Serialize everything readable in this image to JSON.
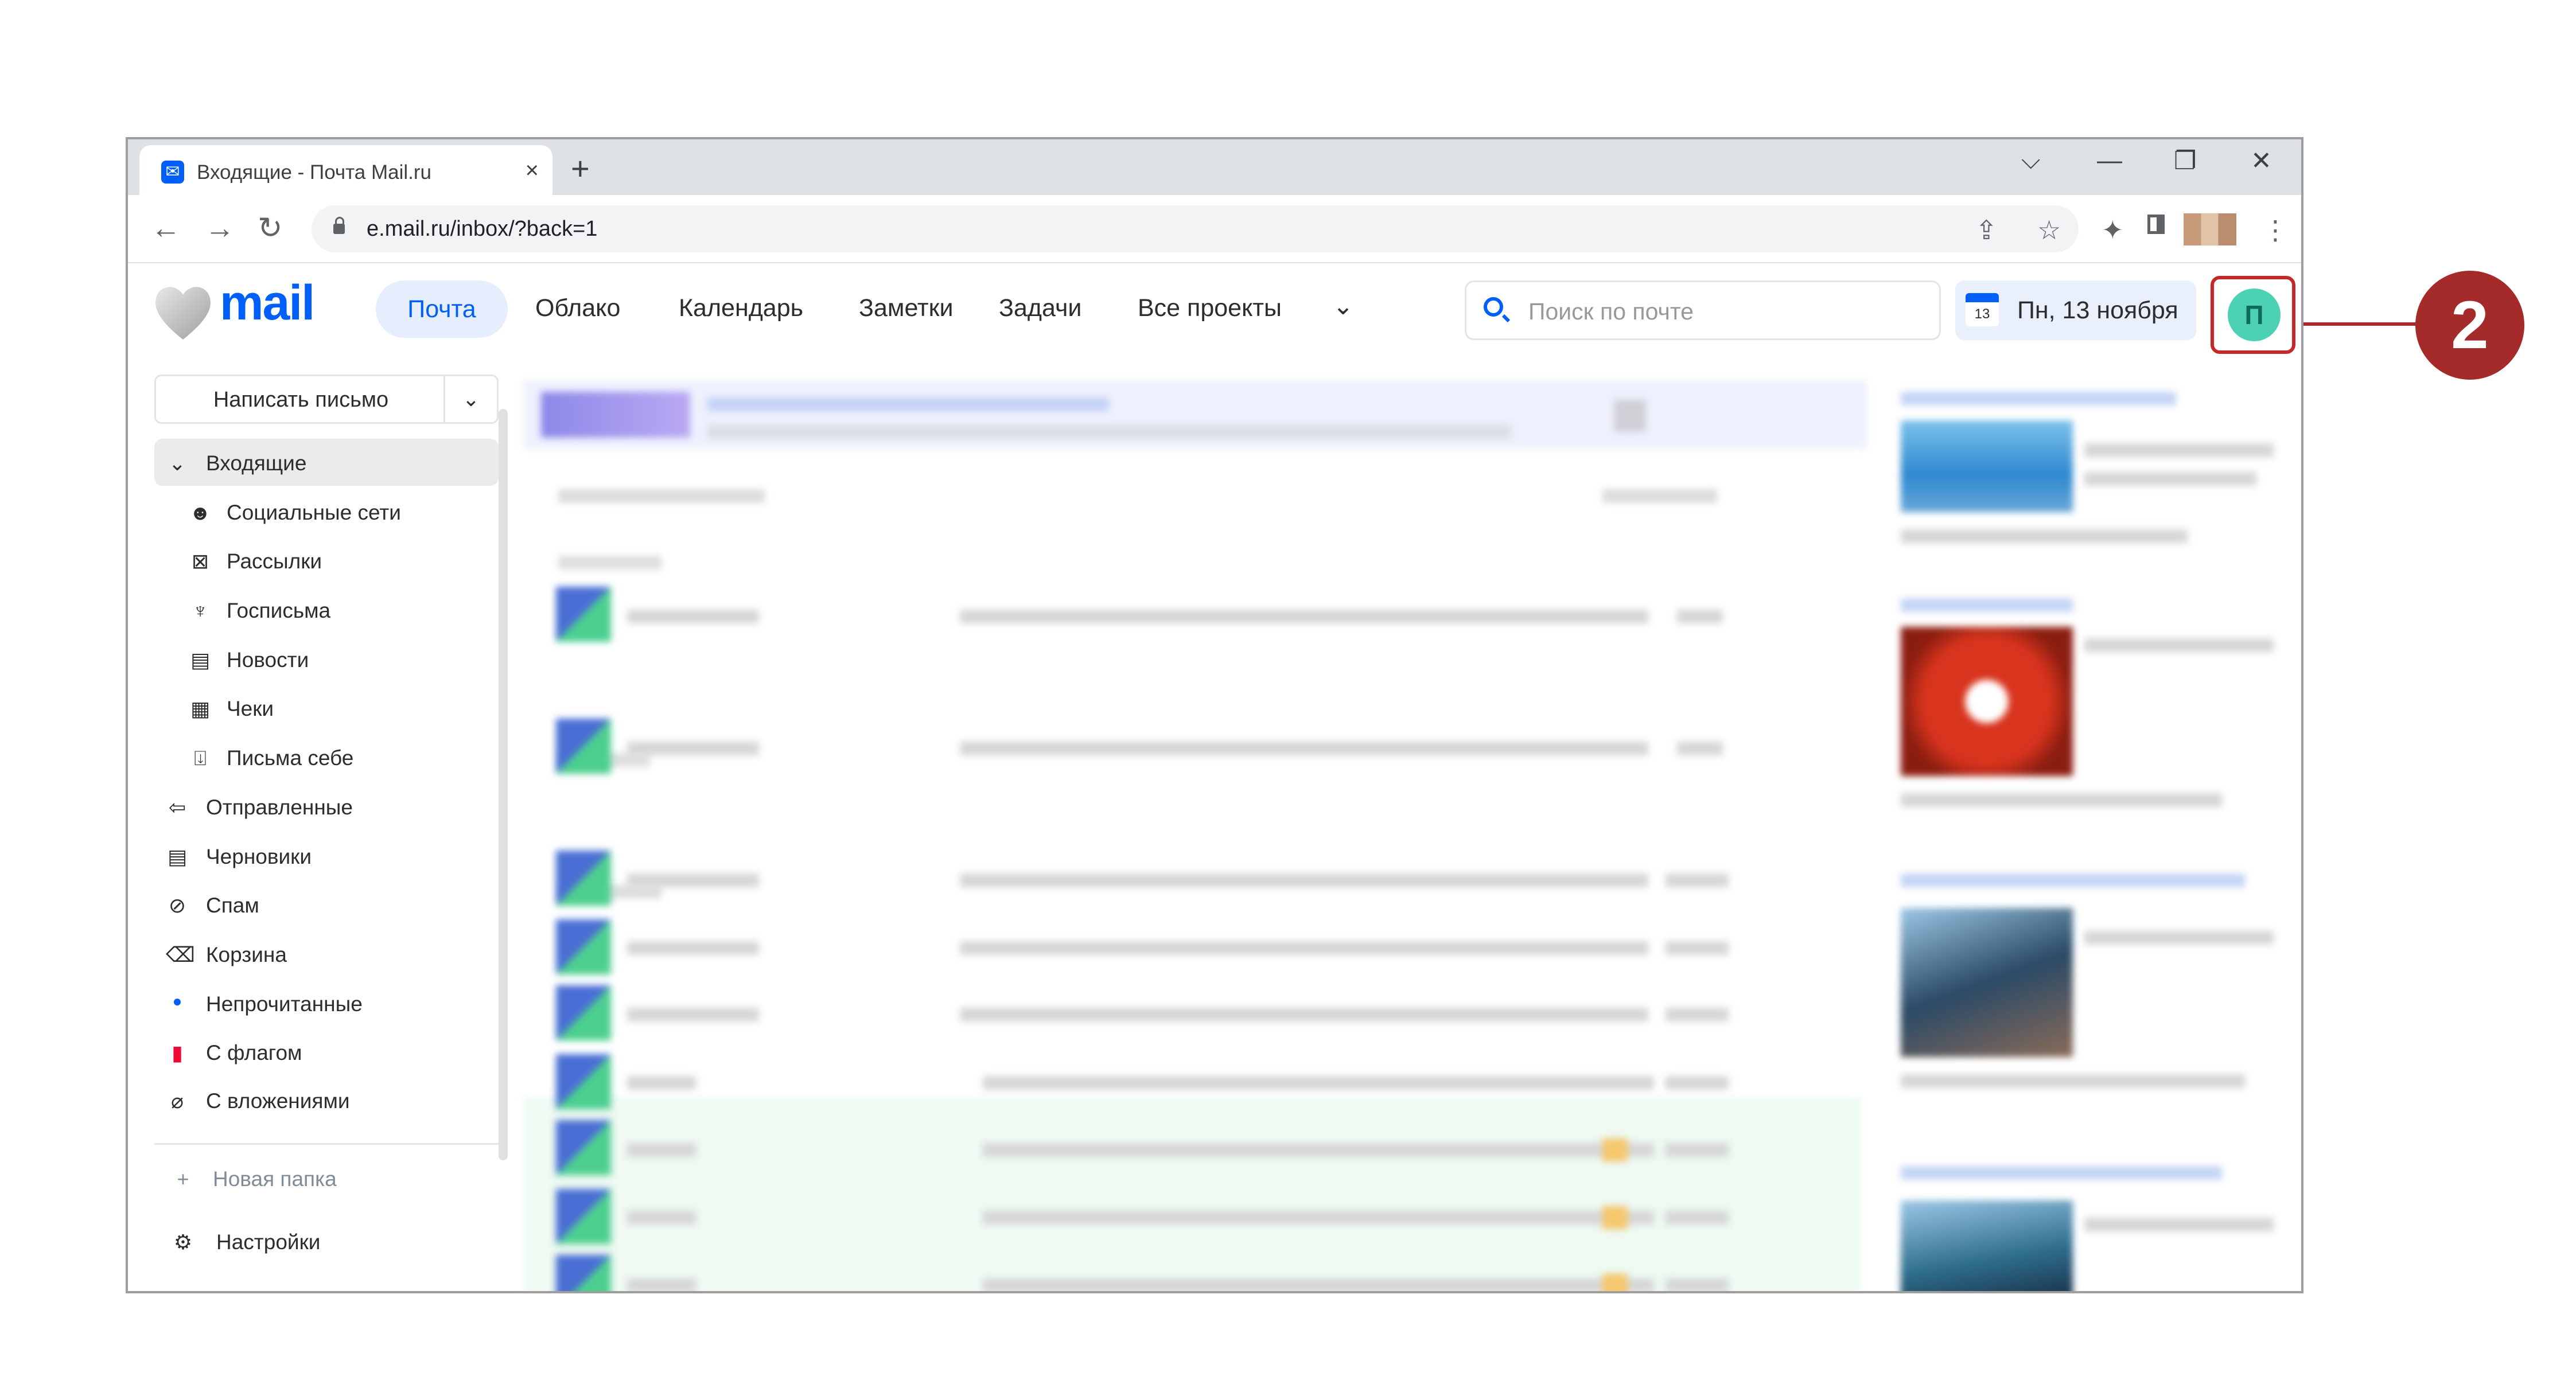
{
  "browser": {
    "tab_title": "Входящие - Почта Mail.ru",
    "tab_close": "×",
    "new_tab": "+",
    "url": "e.mail.ru/inbox/?back=1",
    "win_controls": [
      "⌵",
      "—",
      "❐",
      "✕"
    ]
  },
  "header": {
    "logo": "mail",
    "nav": [
      "Почта",
      "Облако",
      "Календарь",
      "Заметки",
      "Задачи",
      "Все проекты"
    ],
    "nav_more_icon": "chevron-down-icon",
    "search_placeholder": "Поиск по почте",
    "calendar_day": "13",
    "date": "Пн, 13 ноября",
    "avatar_letter": "П"
  },
  "sidebar": {
    "compose": "Написать письмо",
    "inbox": "Входящие",
    "subfolders": [
      "Социальные сети",
      "Рассылки",
      "Госписьма",
      "Новости",
      "Чеки",
      "Письма себе"
    ],
    "folders": [
      "Отправленные",
      "Черновики",
      "Спам",
      "Корзина",
      "Непрочитанные",
      "С флагом",
      "С вложениями"
    ],
    "new_folder": "Новая папка",
    "settings": "Настройки"
  },
  "annotation": {
    "step": "2",
    "accent": "#a52a2a"
  }
}
